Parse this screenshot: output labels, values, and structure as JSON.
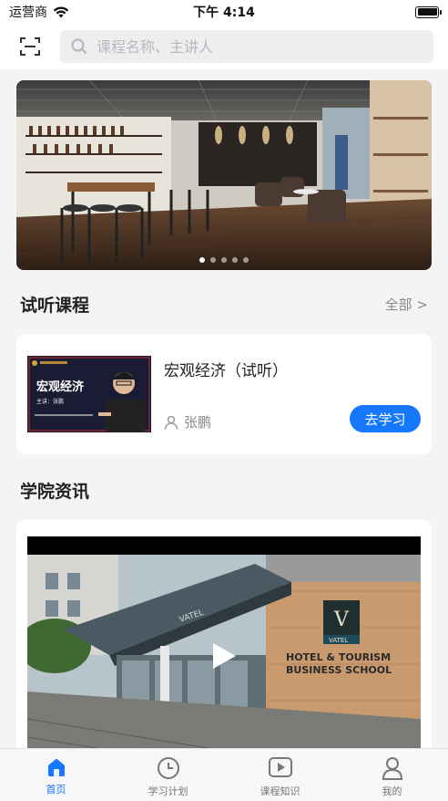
{
  "status_bar": {
    "carrier": "运营商",
    "time": "下午 4:14"
  },
  "search": {
    "placeholder": "课程名称、主讲人"
  },
  "banner": {
    "slide_count": 5,
    "active_index": 0
  },
  "trial_section": {
    "title": "试听课程",
    "more_label": "全部 >"
  },
  "trial_course": {
    "title": "宏观经济（试听）",
    "teacher": "张鹏",
    "button_label": "去学习",
    "thumb_title": "宏观经济",
    "thumb_subtitle": "主讲：张鹏"
  },
  "news_section": {
    "title": "学院资讯"
  },
  "news_video": {
    "sign_line1": "HOTEL & TOURISM",
    "sign_line2": "BUSINESS SCHOOL",
    "logo_letter": "V",
    "logo_text": "VATEL",
    "facade_text": "VATEL"
  },
  "tabbar": {
    "items": [
      {
        "label": "首页",
        "icon": "home-icon",
        "active": true
      },
      {
        "label": "学习计划",
        "icon": "clock-icon",
        "active": false
      },
      {
        "label": "课程知识",
        "icon": "play-box-icon",
        "active": false
      },
      {
        "label": "我的",
        "icon": "user-icon",
        "active": false
      }
    ]
  },
  "colors": {
    "accent": "#1677ff",
    "background": "#f4f4f6"
  }
}
